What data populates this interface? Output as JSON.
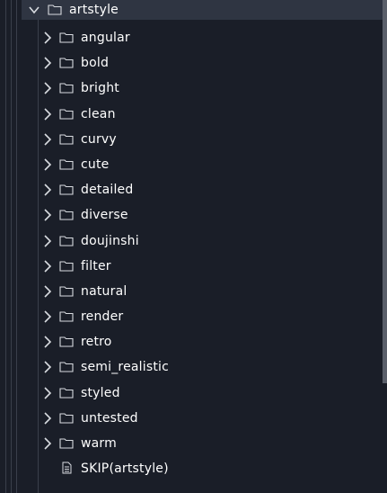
{
  "parent_folder": {
    "label": "artstyle",
    "expanded": true,
    "chevron_icon": "chevron-down-icon",
    "folder_icon": "folder-icon"
  },
  "children": [
    {
      "label": "angular",
      "type": "folder"
    },
    {
      "label": "bold",
      "type": "folder"
    },
    {
      "label": "bright",
      "type": "folder"
    },
    {
      "label": "clean",
      "type": "folder"
    },
    {
      "label": "curvy",
      "type": "folder"
    },
    {
      "label": "cute",
      "type": "folder"
    },
    {
      "label": "detailed",
      "type": "folder"
    },
    {
      "label": "diverse",
      "type": "folder"
    },
    {
      "label": "doujinshi",
      "type": "folder"
    },
    {
      "label": "filter",
      "type": "folder"
    },
    {
      "label": "natural",
      "type": "folder"
    },
    {
      "label": "render",
      "type": "folder"
    },
    {
      "label": "retro",
      "type": "folder"
    },
    {
      "label": "semi_realistic",
      "type": "folder"
    },
    {
      "label": "styled",
      "type": "folder"
    },
    {
      "label": "untested",
      "type": "folder"
    },
    {
      "label": "warm",
      "type": "folder"
    },
    {
      "label": "SKIP(artstyle)",
      "type": "file"
    }
  ],
  "colors": {
    "background": "#1a1e28",
    "selected_row": "#2f3542",
    "text": "#ffffff",
    "icon": "#d8dbe0",
    "guide_line": "#3a3f4b",
    "scrollbar": "#5a5f6a"
  }
}
